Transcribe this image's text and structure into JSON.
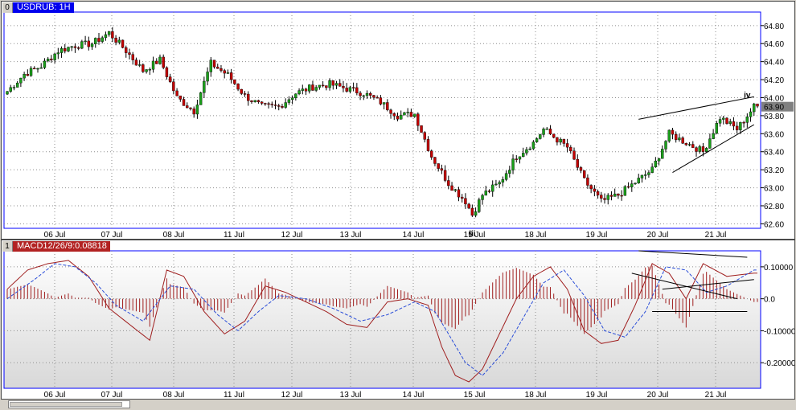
{
  "price_panel": {
    "index": "0",
    "title": "USDRUB: 1H"
  },
  "macd_panel": {
    "index": "1",
    "title": "MACD12/26/9:0.08818"
  },
  "colors": {
    "frame": "#0000ff",
    "grid": "#8e8e8e",
    "up_candle": "#1a9f1a",
    "down_candle": "#c40000",
    "wick": "#000000",
    "macd_line": "#a02020",
    "signal_line": "#2a4dd8",
    "histogram": "#a02020",
    "price_marker": "#808080",
    "trendline": "#000000"
  },
  "chart_data": [
    {
      "type": "candlestick",
      "title": "USDRUB: 1H",
      "x_tick_labels": [
        "06 Jul",
        "07 Jul",
        "08 Jul",
        "11 Jul",
        "12 Jul",
        "13 Jul",
        "14 Jul",
        "15 Jul",
        "18 Jul",
        "19 Jul",
        "20 Jul",
        "21 Jul"
      ],
      "y_tick_labels": [
        "64.80",
        "64.60",
        "64.40",
        "64.20",
        "64.00",
        "63.80",
        "63.60",
        "63.40",
        "63.20",
        "63.00",
        "62.80",
        "62.60"
      ],
      "ylim": [
        62.55,
        64.95
      ],
      "grid": true,
      "current_price_label": "63.90",
      "current_price": 63.9,
      "wave_labels": [
        {
          "text": "iii",
          "x_index": 137,
          "y": 62.54
        },
        {
          "text": "iv",
          "x_index": 218,
          "y": 64.08
        }
      ],
      "close_anchors": [
        [
          0,
          64.07
        ],
        [
          5,
          64.26
        ],
        [
          10,
          64.35
        ],
        [
          15,
          64.52
        ],
        [
          20,
          64.58
        ],
        [
          25,
          64.6
        ],
        [
          30,
          64.72
        ],
        [
          35,
          64.52
        ],
        [
          40,
          64.3
        ],
        [
          45,
          64.42
        ],
        [
          50,
          64.0
        ],
        [
          55,
          63.85
        ],
        [
          60,
          64.38
        ],
        [
          65,
          64.25
        ],
        [
          70,
          64.02
        ],
        [
          75,
          63.9
        ],
        [
          80,
          63.9
        ],
        [
          85,
          64.05
        ],
        [
          90,
          64.12
        ],
        [
          95,
          64.15
        ],
        [
          100,
          64.1
        ],
        [
          105,
          64.05
        ],
        [
          110,
          63.95
        ],
        [
          115,
          63.8
        ],
        [
          120,
          63.82
        ],
        [
          125,
          63.35
        ],
        [
          130,
          63.05
        ],
        [
          135,
          62.85
        ],
        [
          137,
          62.7
        ],
        [
          140,
          62.92
        ],
        [
          145,
          63.05
        ],
        [
          150,
          63.35
        ],
        [
          155,
          63.5
        ],
        [
          158,
          63.65
        ],
        [
          165,
          63.45
        ],
        [
          170,
          63.08
        ],
        [
          175,
          62.85
        ],
        [
          180,
          62.92
        ],
        [
          185,
          63.06
        ],
        [
          190,
          63.2
        ],
        [
          195,
          63.6
        ],
        [
          200,
          63.5
        ],
        [
          205,
          63.4
        ],
        [
          210,
          63.78
        ],
        [
          215,
          63.65
        ],
        [
          220,
          63.9
        ]
      ],
      "trendlines": [
        [
          [
            186,
            63.76
          ],
          [
            220,
            64.01
          ]
        ],
        [
          [
            196,
            63.17
          ],
          [
            220,
            63.7
          ]
        ]
      ]
    },
    {
      "type": "macd",
      "title": "MACD12/26/9:0.08818",
      "params": [
        12,
        26,
        9
      ],
      "last_value": 0.08818,
      "x_tick_labels": [
        "06 Jul",
        "07 Jul",
        "08 Jul",
        "11 Jul",
        "12 Jul",
        "13 Jul",
        "14 Jul",
        "15 Jul",
        "18 Jul",
        "19 Jul",
        "20 Jul",
        "21 Jul"
      ],
      "y_tick_labels": [
        "0.10000",
        "0.0",
        "-0.10000",
        "-0.20000"
      ],
      "ylim": [
        -0.28,
        0.15
      ],
      "grid": true,
      "macd_anchors": [
        [
          0,
          0.03
        ],
        [
          6,
          0.09
        ],
        [
          12,
          0.11
        ],
        [
          18,
          0.12
        ],
        [
          24,
          0.07
        ],
        [
          30,
          -0.03
        ],
        [
          36,
          -0.08
        ],
        [
          42,
          -0.13
        ],
        [
          47,
          0.09
        ],
        [
          52,
          0.07
        ],
        [
          58,
          -0.04
        ],
        [
          64,
          -0.11
        ],
        [
          70,
          -0.07
        ],
        [
          76,
          0.04
        ],
        [
          82,
          0.02
        ],
        [
          88,
          -0.01
        ],
        [
          94,
          -0.04
        ],
        [
          100,
          -0.08
        ],
        [
          106,
          -0.09
        ],
        [
          112,
          -0.01
        ],
        [
          118,
          0.0
        ],
        [
          124,
          -0.02
        ],
        [
          128,
          -0.15
        ],
        [
          132,
          -0.24
        ],
        [
          136,
          -0.26
        ],
        [
          140,
          -0.22
        ],
        [
          145,
          -0.11
        ],
        [
          150,
          0.0
        ],
        [
          155,
          0.07
        ],
        [
          160,
          0.1
        ],
        [
          165,
          0.03
        ],
        [
          170,
          -0.1
        ],
        [
          175,
          -0.14
        ],
        [
          180,
          -0.13
        ],
        [
          185,
          -0.02
        ],
        [
          190,
          0.11
        ],
        [
          195,
          0.08
        ],
        [
          200,
          0.0
        ],
        [
          205,
          0.11
        ],
        [
          212,
          0.07
        ],
        [
          220,
          0.08
        ]
      ],
      "signal_anchors": [
        [
          0,
          0.0
        ],
        [
          8,
          0.06
        ],
        [
          14,
          0.11
        ],
        [
          20,
          0.1
        ],
        [
          26,
          0.05
        ],
        [
          32,
          -0.02
        ],
        [
          40,
          -0.07
        ],
        [
          48,
          0.04
        ],
        [
          55,
          0.03
        ],
        [
          62,
          -0.05
        ],
        [
          68,
          -0.1
        ],
        [
          74,
          -0.04
        ],
        [
          80,
          0.01
        ],
        [
          88,
          0.0
        ],
        [
          96,
          -0.03
        ],
        [
          104,
          -0.07
        ],
        [
          112,
          -0.05
        ],
        [
          120,
          -0.01
        ],
        [
          126,
          -0.04
        ],
        [
          130,
          -0.11
        ],
        [
          135,
          -0.2
        ],
        [
          140,
          -0.24
        ],
        [
          146,
          -0.17
        ],
        [
          152,
          -0.06
        ],
        [
          158,
          0.05
        ],
        [
          164,
          0.09
        ],
        [
          170,
          0.01
        ],
        [
          176,
          -0.1
        ],
        [
          182,
          -0.12
        ],
        [
          188,
          -0.04
        ],
        [
          194,
          0.1
        ],
        [
          200,
          0.09
        ],
        [
          206,
          0.02
        ],
        [
          212,
          0.04
        ],
        [
          220,
          0.09
        ]
      ],
      "trendlines": [
        [
          [
            186,
            0.15
          ],
          [
            218,
            0.13
          ]
        ],
        [
          [
            184,
            0.08
          ],
          [
            215,
            0.0
          ]
        ],
        [
          [
            193,
            0.03
          ],
          [
            220,
            0.06
          ]
        ],
        [
          [
            190,
            -0.04
          ],
          [
            218,
            -0.04
          ]
        ]
      ]
    }
  ]
}
